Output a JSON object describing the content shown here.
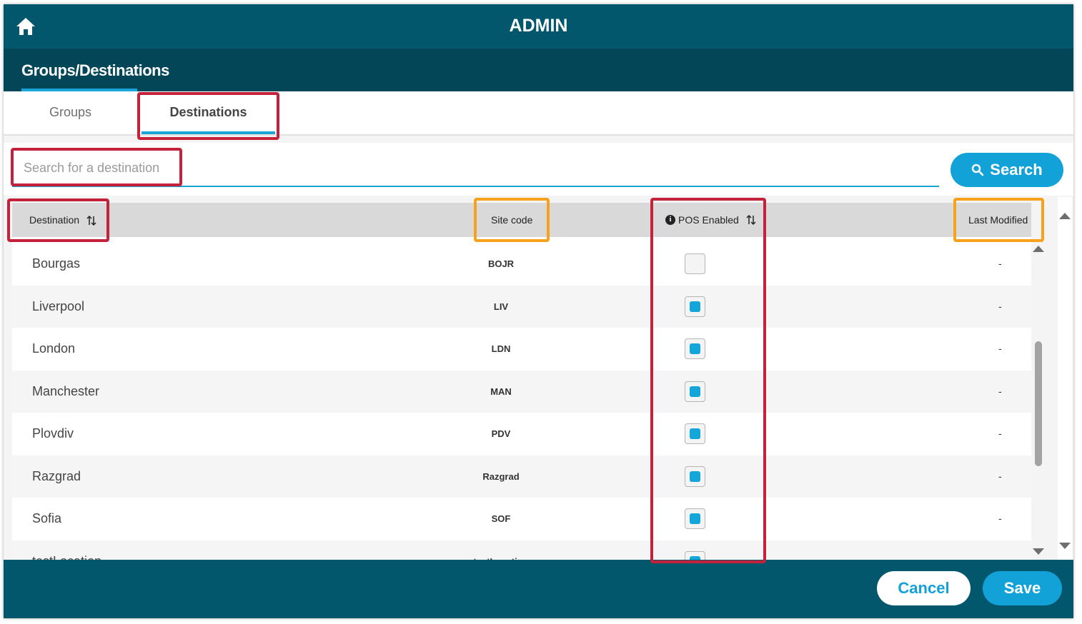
{
  "topbar": {
    "title": "ADMIN",
    "home_icon": "home-icon"
  },
  "subnav": {
    "active_label": "Groups/Destinations"
  },
  "tabs": [
    {
      "label": "Groups",
      "active": false
    },
    {
      "label": "Destinations",
      "active": true
    }
  ],
  "search": {
    "placeholder": "Search for a destination",
    "value": "",
    "button_label": "Search"
  },
  "table": {
    "columns": {
      "destination": "Destination",
      "site_code": "Site code",
      "pos_enabled": "POS Enabled",
      "last_modified": "Last Modified"
    },
    "rows": [
      {
        "destination": "Bourgas",
        "site_code": "BOJR",
        "pos_enabled": false,
        "last_modified": "-"
      },
      {
        "destination": "Liverpool",
        "site_code": "LIV",
        "pos_enabled": true,
        "last_modified": "-"
      },
      {
        "destination": "London",
        "site_code": "LDN",
        "pos_enabled": true,
        "last_modified": "-"
      },
      {
        "destination": "Manchester",
        "site_code": "MAN",
        "pos_enabled": true,
        "last_modified": "-"
      },
      {
        "destination": "Plovdiv",
        "site_code": "PDV",
        "pos_enabled": true,
        "last_modified": "-"
      },
      {
        "destination": "Razgrad",
        "site_code": "Razgrad",
        "pos_enabled": true,
        "last_modified": "-"
      },
      {
        "destination": "Sofia",
        "site_code": "SOF",
        "pos_enabled": true,
        "last_modified": "-"
      },
      {
        "destination": "testLocation",
        "site_code": "testLocation",
        "pos_enabled": true,
        "last_modified": ""
      }
    ]
  },
  "footer": {
    "cancel_label": "Cancel",
    "save_label": "Save"
  },
  "colors": {
    "header_bg": "#03576c",
    "subnav_bg": "#024658",
    "accent": "#12a2d8",
    "highlight_red": "#c3223a",
    "highlight_orange": "#f7a21a"
  }
}
